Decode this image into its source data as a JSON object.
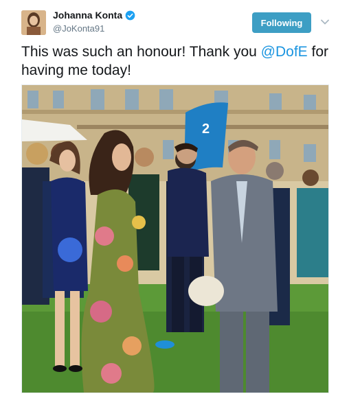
{
  "user": {
    "display_name": "Johanna Konta",
    "handle": "@JoKonta91",
    "verified_icon": "verified-badge-icon"
  },
  "actions": {
    "follow_label": "Following",
    "caret_icon": "chevron-down-icon"
  },
  "tweet": {
    "text_part1": "This was such an honour! Thank you ",
    "mention": "@DofE",
    "text_part2": " for having me today!"
  },
  "photo": {
    "banner_number": "2"
  },
  "colors": {
    "follow_button": "#3d9ec4",
    "mention": "#1b95e0",
    "verified": "#1da1f2"
  }
}
